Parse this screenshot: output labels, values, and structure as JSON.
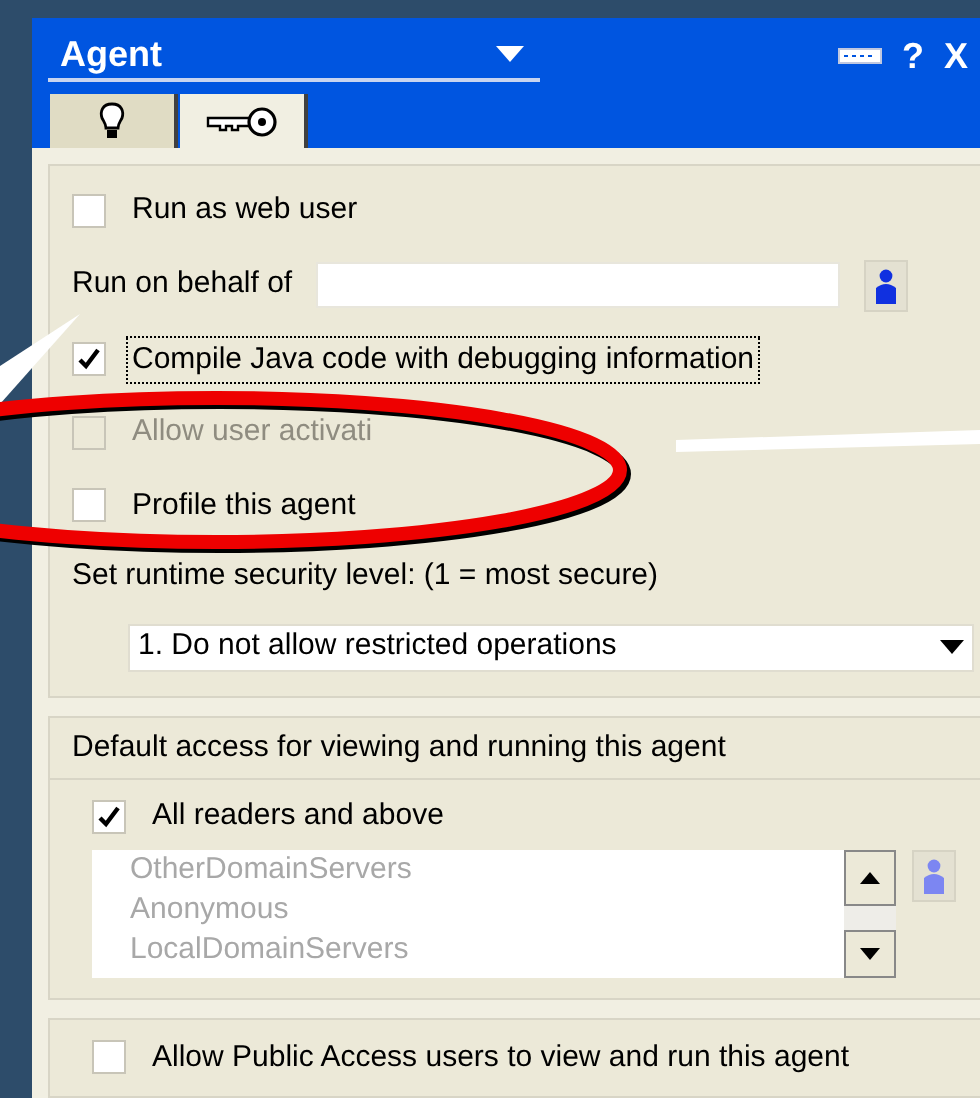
{
  "window": {
    "title": "Agent",
    "help": "?",
    "close": "X"
  },
  "tabs": [
    {
      "kind": "bulb",
      "selected": false
    },
    {
      "kind": "key",
      "selected": true
    }
  ],
  "security": {
    "run_as_web_user": {
      "label": "Run as web user",
      "checked": false
    },
    "run_on_behalf": {
      "label": "Run on behalf of"
    },
    "compile_debug": {
      "label": "Compile Java code with debugging information",
      "checked": true,
      "focused": true
    },
    "allow_activation": {
      "label": "Allow user activati",
      "checked": false,
      "disabled": true
    },
    "profile": {
      "label": "Profile this agent",
      "checked": false
    },
    "runtime_label": "Set runtime security level: (1 = most secure)",
    "runtime_level": {
      "value": "1. Do not allow restricted operations"
    }
  },
  "access": {
    "heading": "Default access for viewing and running this agent",
    "all_readers": {
      "label": "All readers and above",
      "checked": true
    },
    "names": [
      "OtherDomainServers",
      "Anonymous",
      "LocalDomainServers"
    ],
    "names_disabled": true
  },
  "public_access": {
    "label": "Allow Public Access users to view and run this agent",
    "checked": false
  }
}
